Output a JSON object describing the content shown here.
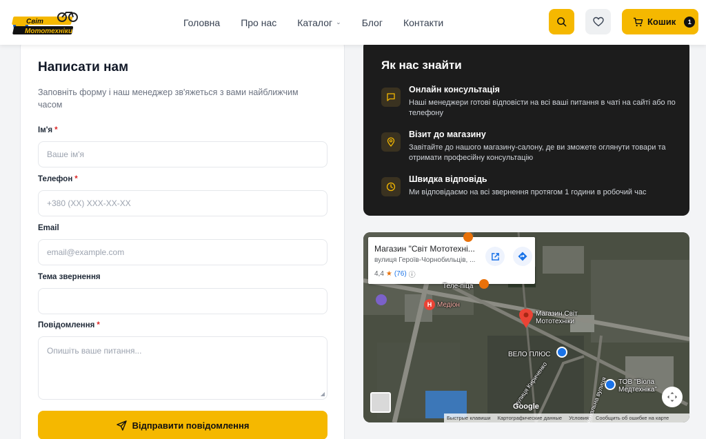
{
  "header": {
    "logo_text": "Світ Мототехніки",
    "nav": [
      {
        "label": "Головна"
      },
      {
        "label": "Про нас"
      },
      {
        "label": "Каталог",
        "has_dropdown": true
      },
      {
        "label": "Блог"
      },
      {
        "label": "Контакти"
      }
    ],
    "cart_label": "Кошик",
    "cart_count": "1",
    "accent": "#f5b800"
  },
  "form": {
    "title": "Написати нам",
    "description": "Заповніть форму і наш менеджер зв'яжеться з вами найближчим часом",
    "name_label": "Ім'я",
    "name_placeholder": "Ваше ім'я",
    "phone_label": "Телефон",
    "phone_placeholder": "+380 (XX) XXX-XX-XX",
    "email_label": "Email",
    "email_placeholder": "email@example.com",
    "subject_label": "Тема звернення",
    "subject_value": "",
    "message_label": "Повідомлення",
    "message_placeholder": "Опишіть ваше питання...",
    "required_mark": "*",
    "submit_label": "Відправити повідомлення"
  },
  "info": {
    "title": "Як нас знайти",
    "items": [
      {
        "icon": "chat-icon",
        "heading": "Онлайн консультація",
        "text": "Наші менеджери готові відповісти на всі ваші питання в чаті на сайті або по телефону"
      },
      {
        "icon": "location-pin-icon",
        "heading": "Візит до магазину",
        "text": "Завітайте до нашого магазину-салону, де ви зможете оглянути товари та отримати професійну консультацію"
      },
      {
        "icon": "clock-icon",
        "heading": "Швидка відповідь",
        "text": "Ми відповідаємо на всі звернення протягом 1 години в робочий час"
      }
    ]
  },
  "map": {
    "place_title": "Магазин \"Світ Мототехні...",
    "place_address": "вулиця Героїв-Чорнобильців, ...",
    "rating": "4,4",
    "reviews": "(76)",
    "labels": {
      "pin": "Магазин Світ Мототехніки",
      "medion": "Медіон",
      "tele": "Теле-піца",
      "velo": "ВЕЛО ПЛЮС",
      "tov": "ТОВ \"Віола Медтехніка\"",
      "street": "вулиця Кириченко",
      "street2": "сигнальна вулиця"
    },
    "google": "Google",
    "footer": [
      "Быстрые клавиши",
      "Картографические данные",
      "Условия",
      "Сообщить об ошибке на карте"
    ]
  }
}
